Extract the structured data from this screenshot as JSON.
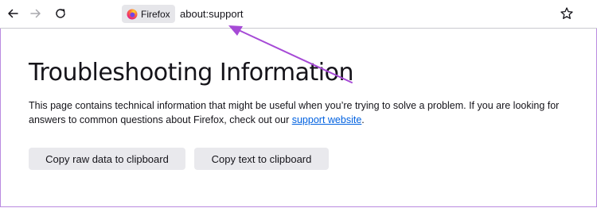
{
  "toolbar": {
    "identity_label": "Firefox",
    "url": "about:support",
    "icons": {
      "back": "back-arrow-icon",
      "forward": "forward-arrow-icon",
      "reload": "reload-icon",
      "bookmark": "star-icon",
      "logo": "firefox-logo-icon"
    }
  },
  "page": {
    "title": "Troubleshooting Information",
    "description_prefix": "This page contains technical information that might be useful when you’re trying to solve a problem. If you are looking for answers to common questions about Firefox, check out our ",
    "link_text": "support website",
    "description_suffix": "."
  },
  "buttons": {
    "copy_raw": "Copy raw data to clipboard",
    "copy_text": "Copy text to clipboard"
  },
  "colors": {
    "annotation": "#a64ad6",
    "link": "#0061e0",
    "button_bg": "#e9e9ed"
  }
}
